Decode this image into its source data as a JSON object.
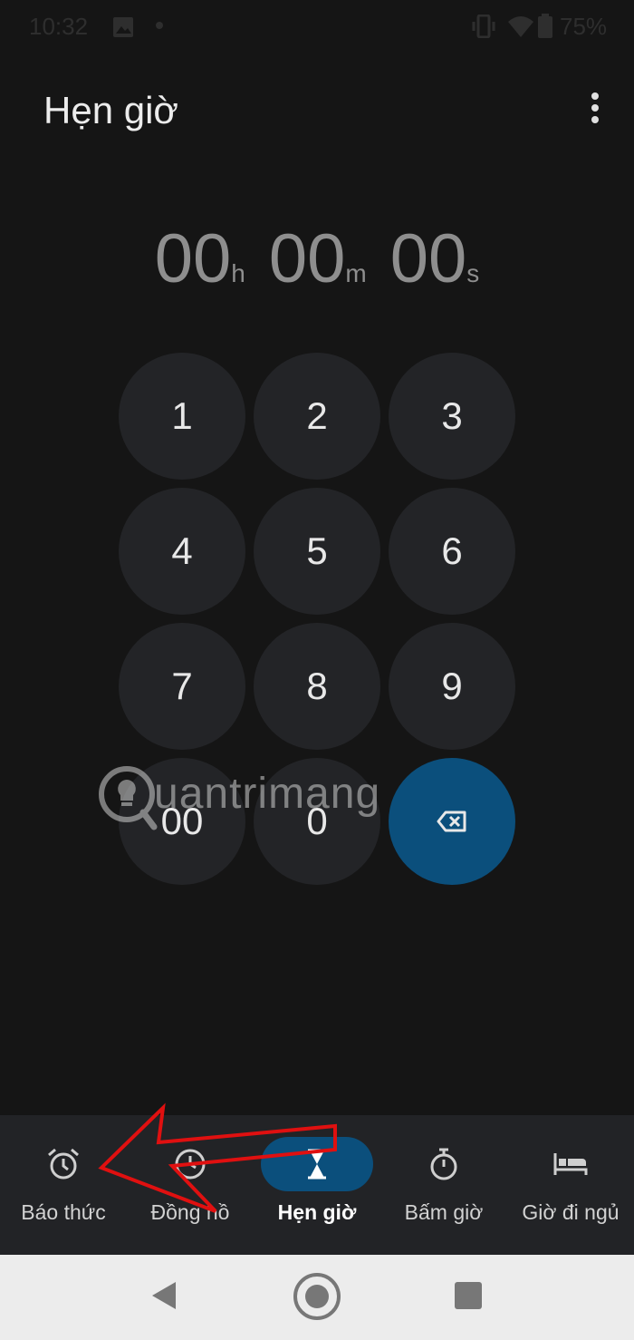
{
  "status_bar": {
    "time": "10:32",
    "battery_percent": "75%",
    "icons": [
      "image-icon",
      "dot-icon",
      "vibrate-icon",
      "wifi-icon",
      "battery-icon"
    ]
  },
  "header": {
    "title": "Hẹn giờ",
    "menu_icon": "more-vert-icon"
  },
  "timer": {
    "hours": "00",
    "hours_unit": "h",
    "minutes": "00",
    "minutes_unit": "m",
    "seconds": "00",
    "seconds_unit": "s"
  },
  "keypad": {
    "keys": [
      "1",
      "2",
      "3",
      "4",
      "5",
      "6",
      "7",
      "8",
      "9",
      "00",
      "0"
    ],
    "backspace_icon": "backspace-icon"
  },
  "watermark": {
    "text": "uantrimang"
  },
  "bottom_nav": {
    "items": [
      {
        "label": "Báo thức",
        "icon": "alarm-icon"
      },
      {
        "label": "Đồng hồ",
        "icon": "clock-icon"
      },
      {
        "label": "Hẹn giờ",
        "icon": "hourglass-icon",
        "active": true
      },
      {
        "label": "Bấm giờ",
        "icon": "stopwatch-icon"
      },
      {
        "label": "Giờ đi ngủ",
        "icon": "bed-icon"
      }
    ]
  },
  "system_nav": {
    "icons": [
      "back-icon",
      "home-icon",
      "recents-icon"
    ]
  },
  "colors": {
    "background": "#151515",
    "accent": "#0b4f7c",
    "key_background": "#232427",
    "annotation_arrow": "#e01010"
  }
}
